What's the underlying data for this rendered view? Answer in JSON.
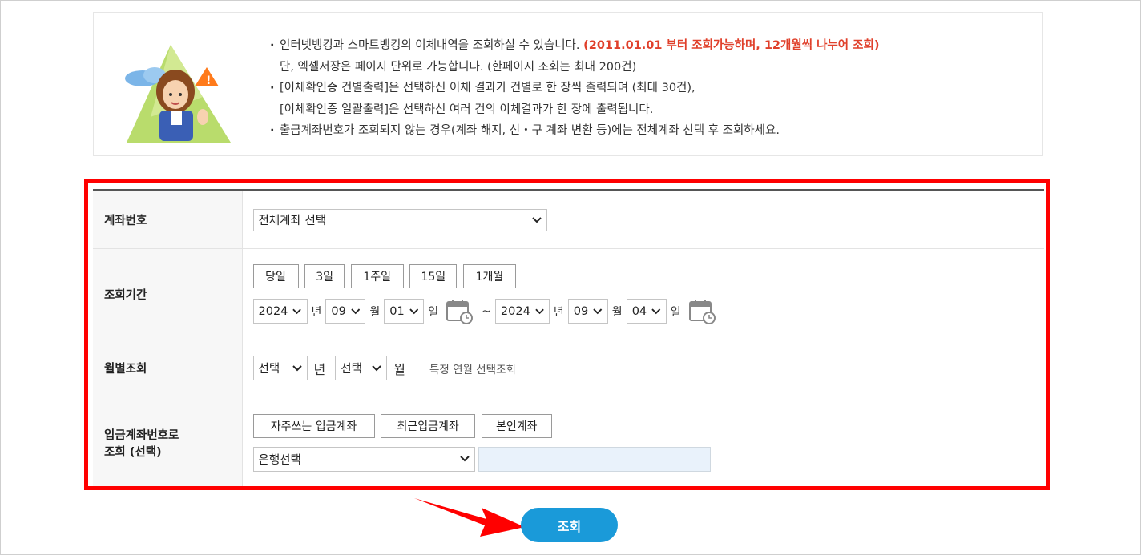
{
  "notice": {
    "line1_text": "인터넷뱅킹과 스마트뱅킹의 이체내역을 조회하실 수 있습니다. ",
    "line1_red": "(2011.01.01 부터 조회가능하며, 12개월씩 나누어 조회)",
    "line2": "단, 엑셀저장은 페이지 단위로 가능합니다. (한페이지 조회는 최대 200건)",
    "line3": "[이체확인증 건별출력]은 선택하신 이체 결과가 건별로 한 장씩 출력되며 (최대 30건),",
    "line4": "[이체확인증 일괄출력]은 선택하신 여러 건의 이체결과가 한 장에 출력됩니다.",
    "line5": "출금계좌번호가 조회되지 않는 경우(계좌 해지, 신・구 계좌 변환 등)에는 전체계좌 선택 후 조회하세요."
  },
  "form": {
    "account": {
      "label": "계좌번호",
      "value": "전체계좌 선택"
    },
    "period": {
      "label": "조회기간",
      "quick_buttons": [
        "당일",
        "3일",
        "1주일",
        "15일",
        "1개월"
      ],
      "start": {
        "year": "2024",
        "month": "09",
        "day": "01"
      },
      "end": {
        "year": "2024",
        "month": "09",
        "day": "04"
      },
      "unit_year": "년",
      "unit_month": "월",
      "unit_day": "일",
      "separator": "~"
    },
    "monthly": {
      "label": "월별조회",
      "year_value": "선택",
      "month_value": "선택",
      "unit_year": "년",
      "unit_month": "월",
      "hint": "특정 연월 선택조회"
    },
    "deposit": {
      "label_line1": "입금계좌번호로",
      "label_line2": "조회 (선택)",
      "buttons": [
        "자주쓰는 입금계좌",
        "최근입금계좌",
        "본인계좌"
      ],
      "bank_value": "은행선택",
      "account_input": ""
    }
  },
  "submit_label": "조회",
  "colors": {
    "highlight": "#ff0000",
    "primary": "#1a9ad9",
    "notice_red": "#e0402b"
  }
}
